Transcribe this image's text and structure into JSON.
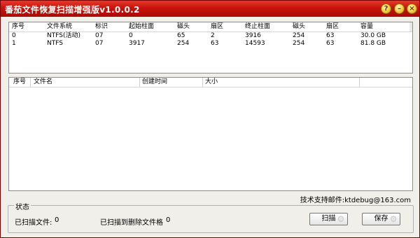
{
  "window": {
    "title": "番茄文件恢复扫描增强版v1.0.0.2",
    "accent": "#c8130b"
  },
  "titlebar_buttons": [
    "help-icon",
    "minimize-icon",
    "close-icon"
  ],
  "partitions": {
    "columns": [
      "序号",
      "文件系统",
      "标识",
      "起始柱面",
      "磁头",
      "扇区",
      "终止柱面",
      "磁头",
      "扇区",
      "容量"
    ],
    "rows": [
      [
        "0",
        "NTFS(活动)",
        "07",
        "0",
        "65",
        "2",
        "3916",
        "254",
        "63",
        "30.0 GB"
      ],
      [
        "1",
        "NTFS",
        "07",
        "3917",
        "254",
        "63",
        "14593",
        "254",
        "63",
        "81.8 GB"
      ]
    ]
  },
  "files": {
    "columns": [
      "序号",
      "文件名",
      "创建时间",
      "大小"
    ],
    "rows": []
  },
  "support": {
    "text": "技术支持邮件:ktdebug@163.com"
  },
  "status": {
    "label": "状态",
    "scanned_label": "已扫描文件:",
    "scanned_value": "0",
    "deleted_label": "已扫描到删除文件格",
    "deleted_value": "0"
  },
  "buttons": {
    "scan": "扫描",
    "save": "保存"
  }
}
